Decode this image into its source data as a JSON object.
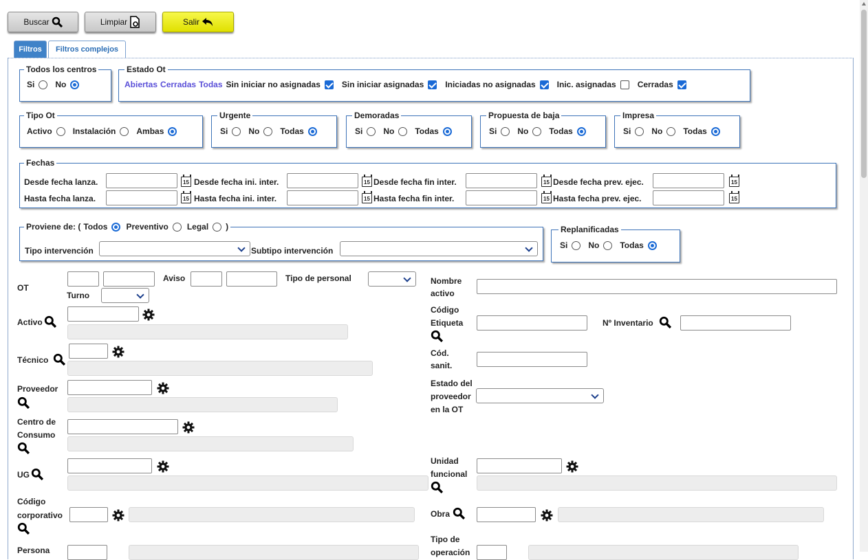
{
  "toolbar": {
    "search_label": "Buscar",
    "clear_label": "Limpiar",
    "exit_label": "Salir"
  },
  "tabs": [
    {
      "label": "Filtros"
    },
    {
      "label": "Filtros complejos"
    }
  ],
  "todos_centros": {
    "legend": "Todos los centros",
    "options": [
      "Si",
      "No"
    ],
    "selected": "No"
  },
  "estado_ot": {
    "legend": "Estado Ot",
    "links": [
      "Abiertas",
      "Cerradas",
      "Todas"
    ],
    "checks": [
      {
        "label": "Sin iniciar no asignadas",
        "checked": true
      },
      {
        "label": "Sin iniciar asignadas",
        "checked": true
      },
      {
        "label": "Iniciadas no asignadas",
        "checked": true
      },
      {
        "label": "Inic. asignadas",
        "checked": false
      },
      {
        "label": "Cerradas",
        "checked": true
      }
    ]
  },
  "tipo_ot": {
    "legend": "Tipo Ot",
    "options": [
      "Activo",
      "Instalación",
      "Ambas"
    ],
    "selected": "Ambas"
  },
  "urgente": {
    "legend": "Urgente",
    "options": [
      "Si",
      "No",
      "Todas"
    ],
    "selected": "Todas"
  },
  "demoradas": {
    "legend": "Demoradas",
    "options": [
      "Si",
      "No",
      "Todas"
    ],
    "selected": "Todas"
  },
  "propuesta_baja": {
    "legend": "Propuesta de baja",
    "options": [
      "Si",
      "No",
      "Todas"
    ],
    "selected": "Todas"
  },
  "impresa": {
    "legend": "Impresa",
    "options": [
      "Si",
      "No",
      "Todas"
    ],
    "selected": "Todas"
  },
  "fechas": {
    "legend": "Fechas",
    "calendar_day": "15",
    "desde": [
      "Desde fecha lanza.",
      "Desde fecha ini. inter.",
      "Desde fecha fin inter.",
      "Desde fecha prev. ejec."
    ],
    "hasta": [
      "Hasta fecha lanza.",
      "Hasta fecha ini. inter.",
      "Hasta fecha fin inter.",
      "Hasta fecha prev. ejec."
    ]
  },
  "proviene": {
    "legend": "Proviene de: (",
    "legend_end": ")",
    "options": [
      "Todos",
      "Preventivo",
      "Legal"
    ],
    "selected": "Todos",
    "tipo_intervencion": "Tipo intervención",
    "subtipo_intervencion": "Subtipo intervención"
  },
  "replanificadas": {
    "legend": "Replanificadas",
    "options": [
      "Si",
      "No",
      "Todas"
    ],
    "selected": "Todas"
  },
  "fields": {
    "ot": "OT",
    "aviso": "Aviso",
    "tipo_personal": "Tipo de personal",
    "turno": "Turno",
    "nombre_activo_1": "Nombre",
    "nombre_activo_2": "activo",
    "activo": "Activo",
    "codigo_etiqueta_1": "Código",
    "codigo_etiqueta_2": "Etiqueta",
    "n_inventario": "Nº Inventario",
    "tecnico": "Técnico",
    "cod_sanit_1": "Cód.",
    "cod_sanit_2": "sanit.",
    "proveedor": "Proveedor",
    "estado_proveedor_1": "Estado del",
    "estado_proveedor_2": "proveedor",
    "estado_proveedor_3": "en la OT",
    "centro_consumo_1": "Centro de",
    "centro_consumo_2": "Consumo",
    "ug": "UG",
    "unidad_funcional_1": "Unidad",
    "unidad_funcional_2": "funcional",
    "codigo_corporativo_1": "Código",
    "codigo_corporativo_2": "corporativo",
    "obra": "Obra",
    "peticionario": "Persona",
    "tipo_operacion_1": "Tipo de",
    "tipo_operacion_2": "operación"
  }
}
